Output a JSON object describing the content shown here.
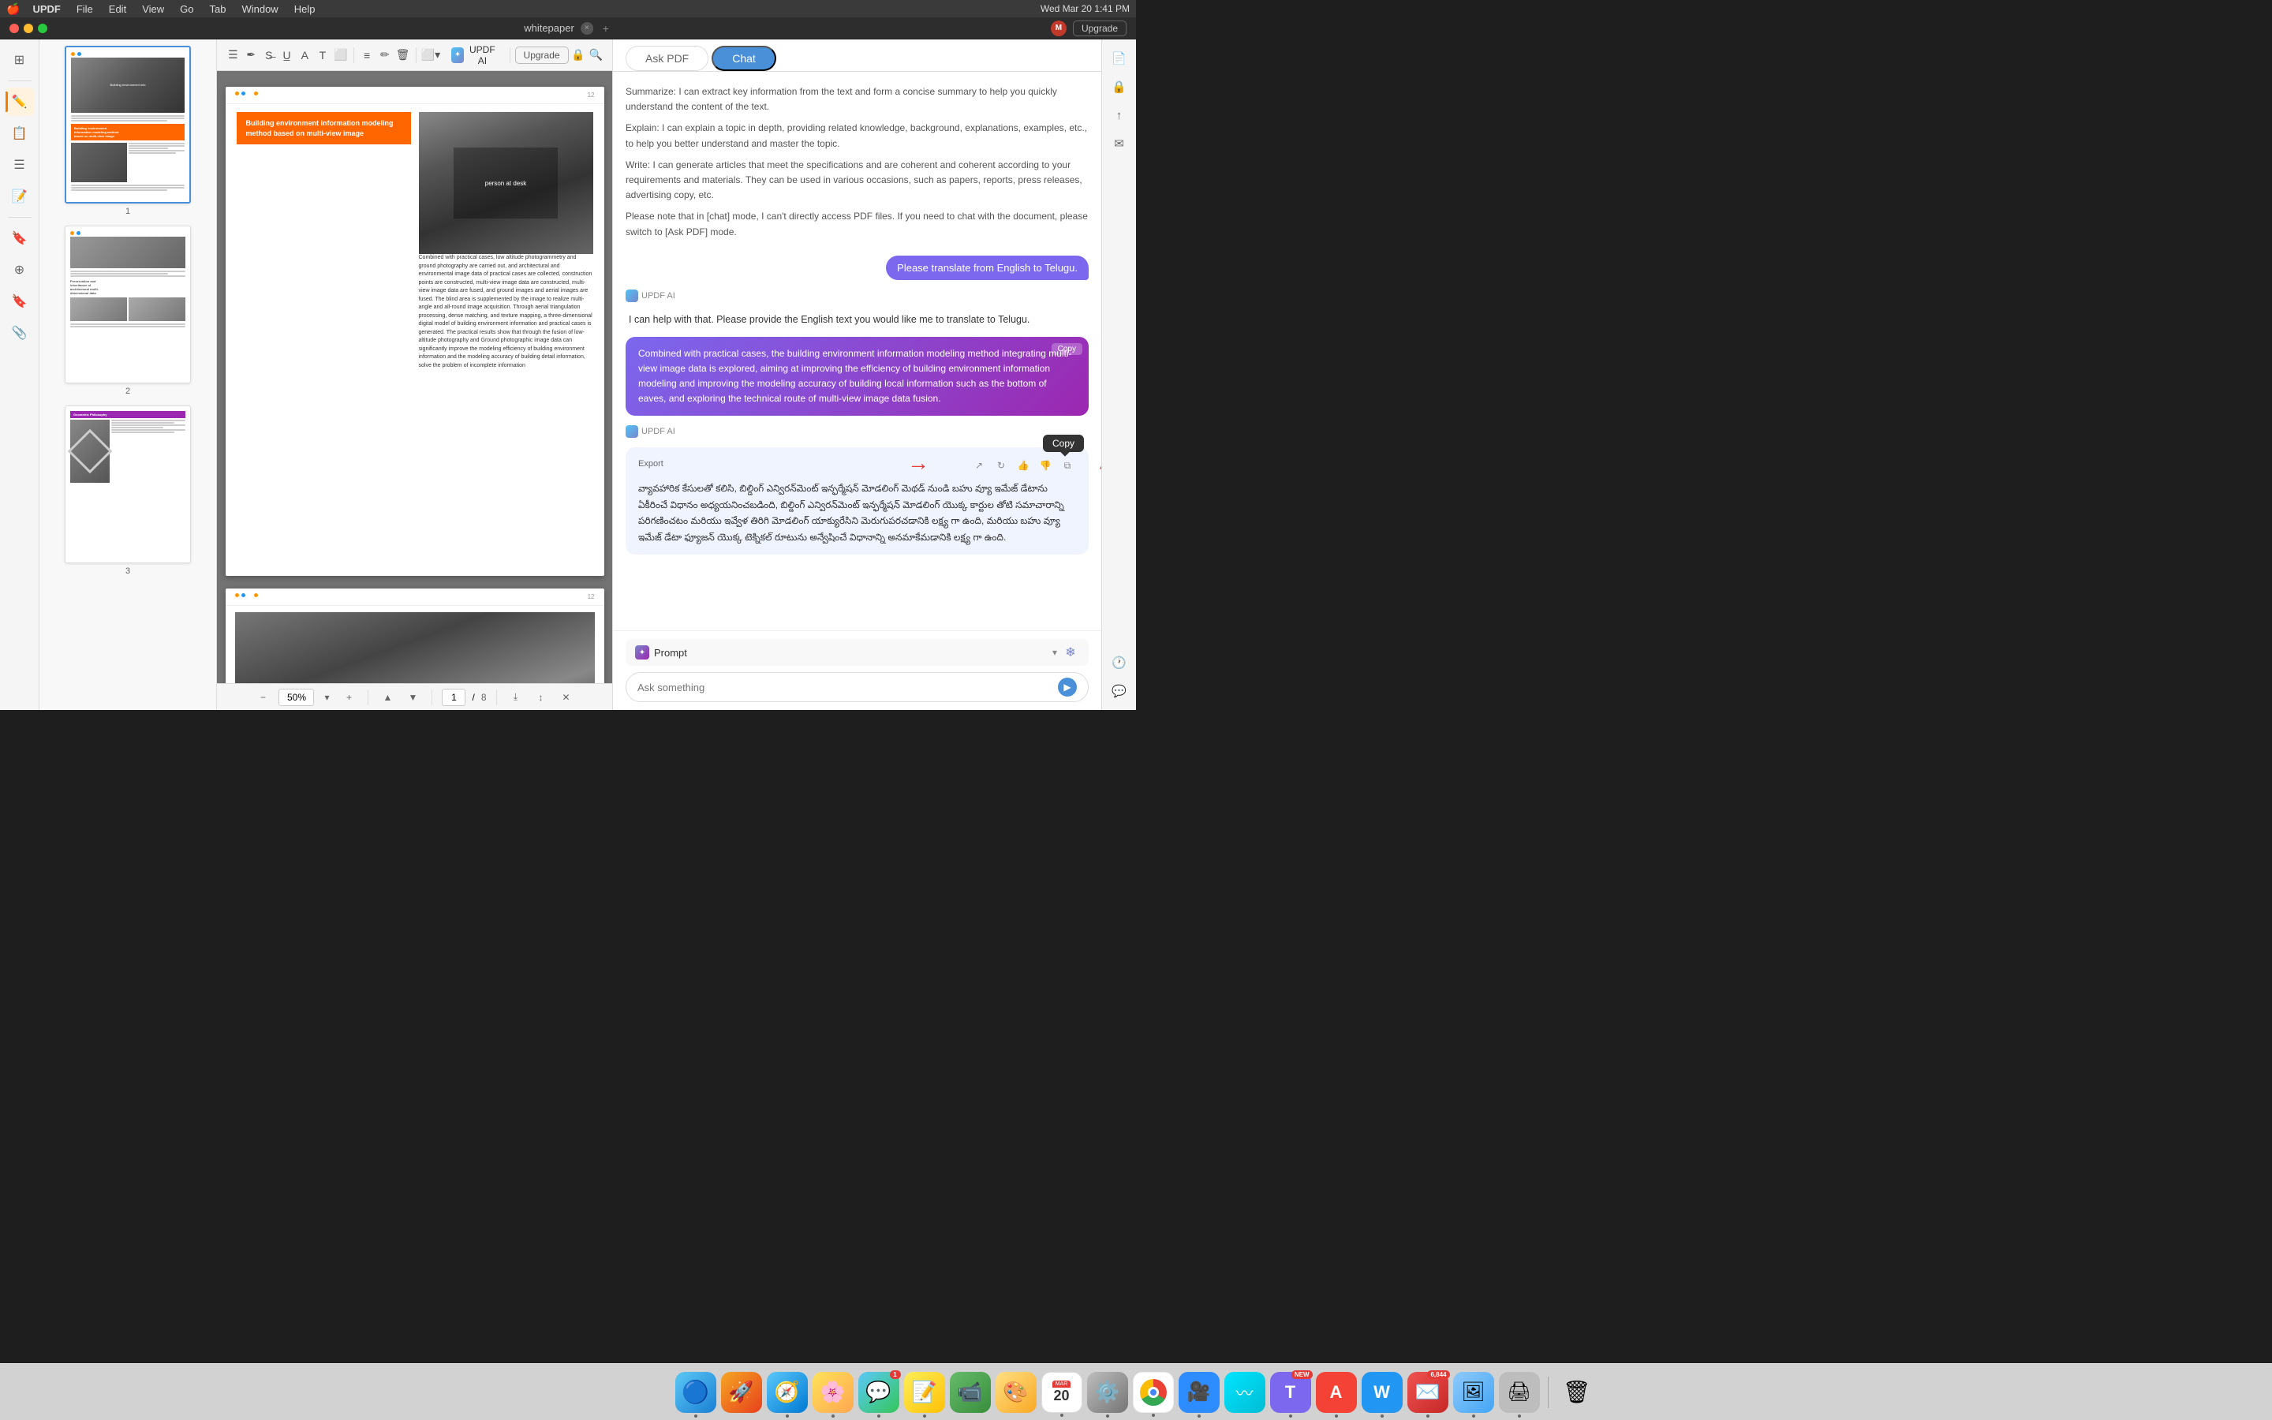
{
  "menubar": {
    "apple": "🍎",
    "app_name": "UPDF",
    "menus": [
      "File",
      "Edit",
      "View",
      "Go",
      "Tab",
      "Window",
      "Help"
    ],
    "time": "Wed Mar 20  1:41 PM"
  },
  "titlebar": {
    "tab_name": "whitepaper",
    "upgrade_label": "Upgrade"
  },
  "toolbar": {
    "updf_ai_label": "UPDF AI",
    "upgrade_label": "Upgrade"
  },
  "left_sidebar": {
    "icons": [
      "📄",
      "🖊️",
      "📋",
      "🔖",
      "📎"
    ]
  },
  "pdf": {
    "zoom": "50%",
    "current_page": "1",
    "total_pages": "8",
    "page1": {
      "header_dots": "●● ●",
      "page_num": "12",
      "title": "Building environment information modeling method based on multi-view image",
      "text": "Combined with practical cases, low altitude photogrammetry and ground photography are carried out, and architectural and environmental image data of practical cases are collected, construction points are constructed, multi-view image data are constructed, multi-view image data are fused, and ground images and aerial images are fused. The blind area is supplemented by the image to realize multi-angle and all-round image acquisition. Through aerial triangulation processing, dense matching, and texture mapping, a three-dimensional digital model of building environment information and practical cases is generated. The practical results show that through the fusion of low-altitude photography and Ground photographic image data can significantly improve the modeling efficiency of building environment information and the modeling accuracy of building detail information, solve the problem of incomplete information"
    },
    "page2": {
      "header_dots": "●● ●",
      "page_num": "12"
    }
  },
  "chat": {
    "ask_pdf_tab": "Ask PDF",
    "chat_tab": "Chat",
    "messages": [
      {
        "type": "system",
        "texts": [
          "Summarize: I can extract key information from the text and form a concise summary to help you quickly understand the content of the text.",
          "Explain: I can explain a topic in depth, providing related knowledge, background, explanations, examples, etc., to help you better understand and master the topic.",
          "Write: I can generate articles that meet the specifications and are coherent and coherent according to your requirements and materials. They can be used in various occasions, such as papers, reports, press releases, advertising copy, etc.",
          "Please note that in [chat] mode, I can't directly access PDF files. If you need to chat with the document, please switch to [Ask PDF] mode."
        ]
      },
      {
        "type": "user",
        "text": "Please translate from English to Telugu."
      },
      {
        "type": "ai_label",
        "label": "UPDF AI"
      },
      {
        "type": "ai",
        "text": "I can help with that. Please provide the English text you would like me to translate to Telugu."
      },
      {
        "type": "user_highlight",
        "text": "Combined with practical cases, the building environment information modeling method integrating multi-view image data is explored, aiming at improving the efficiency of building environment information modeling and improving the modeling accuracy of building local information such as the bottom of eaves, and exploring the technical route of multi-view image data fusion."
      },
      {
        "type": "ai_label2",
        "label": "UPDF AI"
      },
      {
        "type": "ai_telugu",
        "export_label": "Export",
        "text": "వ్యావహారిక కేసులతో కలిసి, బిల్డింగ్ ఎన్విరన్‌మెంట్ ఇన్ఫర్మేషన్ మోడలింగ్ మెథడ్ నుండి బహు వ్యూ ఇమేజ్ డేటాను ఏకీరించే విధానం అధ్యయనించబడింది, బిల్డింగ్ ఎన్విరన్‌మెంట్ ఇన్ఫర్మేషన్ మోడలింగ్ యొక్క కార్టుల తోటి సమాచారాన్ని పరిగణించటం మరియు ఇవ్వేళ తిరిగి మోడలింగ్ యాక్యురేసిని మెరుగుపరచడానికి లక్ష్య గా ఉంది, మరియు బహు వ్యూ ఇమేజ్ డేటా ఫ్యూజన్ యొక్క టెక్నికల్ రూటును అన్వేషించే విధానాన్ని అనమాకేమడానికి లక్ష్య గా ఉంది."
      }
    ],
    "prompt_label": "Prompt",
    "ask_placeholder": "Ask something",
    "copy_label": "Copy"
  },
  "thumbnails": [
    {
      "num": "1"
    },
    {
      "num": "2"
    },
    {
      "num": "3"
    }
  ],
  "dock": {
    "items": [
      {
        "name": "Finder",
        "color": "#4a90d9",
        "icon": "🔵"
      },
      {
        "name": "Launchpad",
        "color": "#ff6b35",
        "icon": "🚀"
      },
      {
        "name": "Safari",
        "color": "#4a90d9",
        "icon": "🧭"
      },
      {
        "name": "Photos",
        "color": "#e91e63",
        "icon": "🌸"
      },
      {
        "name": "Messages",
        "color": "#4caf50",
        "icon": "💬",
        "badge": "1"
      },
      {
        "name": "Notes",
        "color": "#ffeb3b",
        "icon": "📝"
      },
      {
        "name": "FaceTime",
        "color": "#4caf50",
        "icon": "📹"
      },
      {
        "name": "Miro",
        "color": "#ff9800",
        "icon": "🎨"
      },
      {
        "name": "Settings",
        "color": "#9e9e9e",
        "icon": "⚙️"
      },
      {
        "name": "Chrome",
        "color": "#4285f4",
        "icon": "🌐"
      },
      {
        "name": "Zoom",
        "color": "#2196f3",
        "icon": "🎥"
      },
      {
        "name": "Wave",
        "color": "#00bcd4",
        "icon": "〜"
      },
      {
        "name": "Teams",
        "color": "#7b68ee",
        "icon": "T",
        "badge": "NEW"
      },
      {
        "name": "Acrobat",
        "color": "#f44336",
        "icon": "A"
      },
      {
        "name": "Word",
        "color": "#2196f3",
        "icon": "W"
      },
      {
        "name": "Mail",
        "color": "#ef5350",
        "icon": "✉️",
        "badge": "6844"
      },
      {
        "name": "Preview",
        "color": "#4a90d9",
        "icon": "👁"
      },
      {
        "name": "PrintMonitor",
        "color": "#9e9e9e",
        "icon": "🖨"
      },
      {
        "name": "Trash",
        "color": "#9e9e9e",
        "icon": "🗑"
      }
    ]
  }
}
